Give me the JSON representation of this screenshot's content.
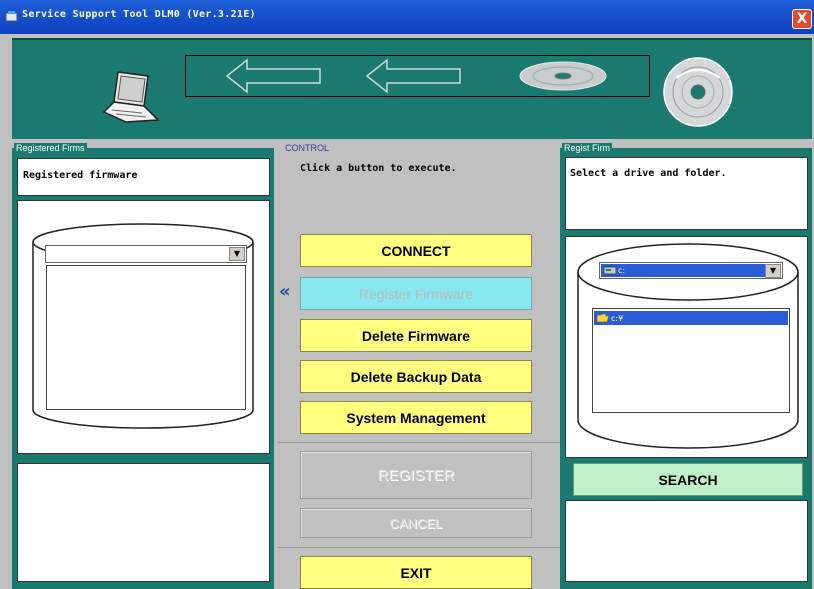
{
  "window": {
    "title": "Service Support Tool DLM0 (Ver.3.21E)",
    "close_label": "X"
  },
  "left_panel": {
    "frame_label": "Registered Firms",
    "info_text": "Registered firmware"
  },
  "control": {
    "frame_label": "CONTROL",
    "instruction": "Click a button to execute.",
    "arrow_indicator": "«",
    "buttons": {
      "connect": "CONNECT",
      "register_firmware": "Register Firmware",
      "delete_firmware": "Delete Firmware",
      "delete_backup": "Delete Backup Data",
      "system_management": "System Management",
      "register": "REGISTER",
      "cancel": "CANCEL",
      "exit": "EXIT"
    }
  },
  "right_panel": {
    "frame_label": "Regist Firm",
    "info_text": "Select a drive and folder.",
    "drive_value": "c:",
    "folder_item": "c:¥",
    "search_label": "SEARCH"
  },
  "colors": {
    "teal": "#1a7a70",
    "button_yellow": "#ffff80",
    "button_cyan_disabled": "#88e8f0",
    "search_green": "#c0f0c8",
    "selection_blue": "#2a5cd6"
  }
}
